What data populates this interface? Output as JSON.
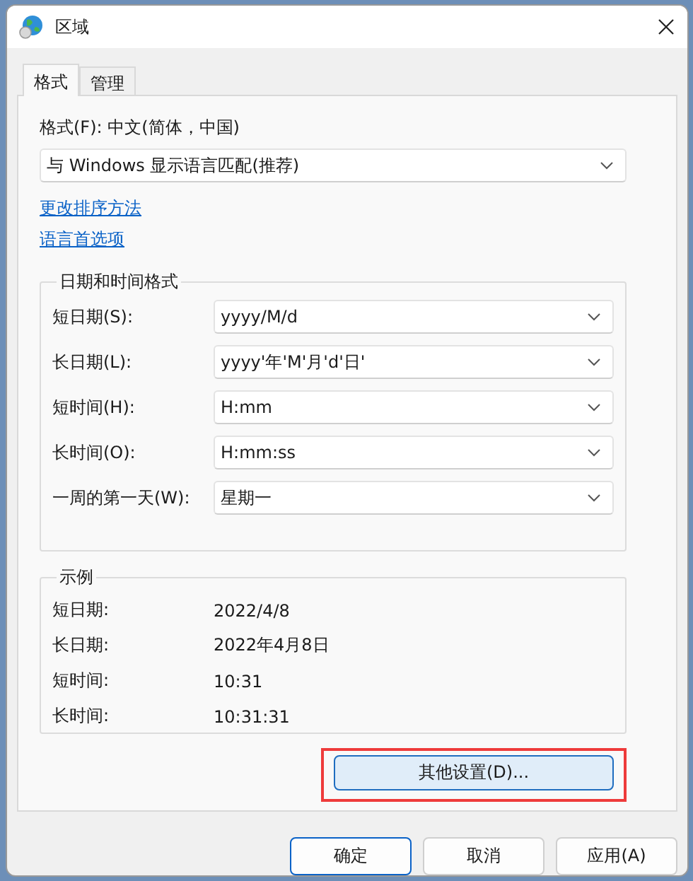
{
  "window": {
    "title": "区域"
  },
  "tabs": [
    {
      "label": "格式",
      "selected": true
    },
    {
      "label": "管理",
      "selected": false
    }
  ],
  "format": {
    "label": "格式(F): 中文(简体，中国)",
    "value": "与 Windows 显示语言匹配(推荐)"
  },
  "links": [
    "更改排序方法",
    "语言首选项"
  ],
  "date_time_formats": {
    "title": "日期和时间格式",
    "rows": [
      {
        "label": "短日期(S):",
        "value": "yyyy/M/d"
      },
      {
        "label": "长日期(L):",
        "value": "yyyy'年'M'月'd'日'"
      },
      {
        "label": "短时间(H):",
        "value": "H:mm"
      },
      {
        "label": "长时间(O):",
        "value": "H:mm:ss"
      },
      {
        "label": "一周的第一天(W):",
        "value": "星期一"
      }
    ]
  },
  "examples": {
    "title": "示例",
    "rows": [
      {
        "label": "短日期:",
        "value": "2022/4/8"
      },
      {
        "label": "长日期:",
        "value": "2022年4月8日"
      },
      {
        "label": "短时间:",
        "value": "10:31"
      },
      {
        "label": "长时间:",
        "value": "10:31:31"
      }
    ]
  },
  "additional_settings": {
    "label": "其他设置(D)...",
    "highlighted": true
  },
  "buttons": [
    {
      "label": "确定",
      "default": true
    },
    {
      "label": "取消",
      "default": false
    },
    {
      "label": "应用(A)",
      "default": false
    }
  ]
}
